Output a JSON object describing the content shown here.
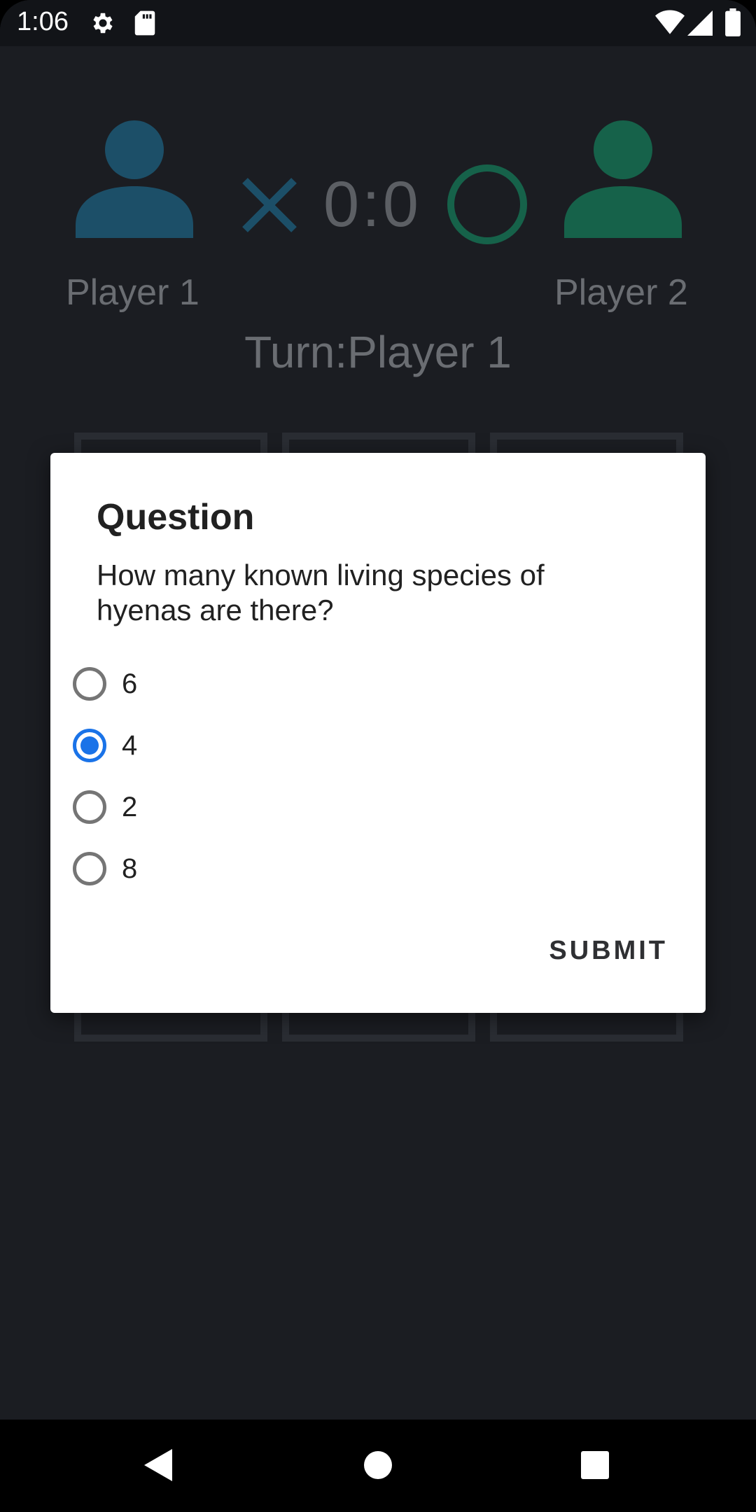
{
  "status_bar": {
    "time": "1:06",
    "icons": [
      "settings-icon",
      "sd-card-icon",
      "wifi-icon",
      "signal-icon",
      "battery-icon"
    ]
  },
  "game": {
    "player1": {
      "name": "Player 1",
      "icon": "person-icon",
      "color": "#1c4f68"
    },
    "player2": {
      "name": "Player 2",
      "icon": "person-icon",
      "color": "#16624a"
    },
    "score": "0:0",
    "player1_mark": "x-icon",
    "player2_mark": "o-icon",
    "turn_label": "Turn:Player 1"
  },
  "dialog": {
    "title": "Question",
    "question": "How many known living species of hyenas are there?",
    "options": [
      "6",
      "4",
      "2",
      "8"
    ],
    "selected_index": 1,
    "submit_label": "SUBMIT",
    "accent_color": "#1a73e8"
  },
  "nav_bar": {
    "buttons": [
      "back-icon",
      "home-icon",
      "recents-icon"
    ]
  }
}
